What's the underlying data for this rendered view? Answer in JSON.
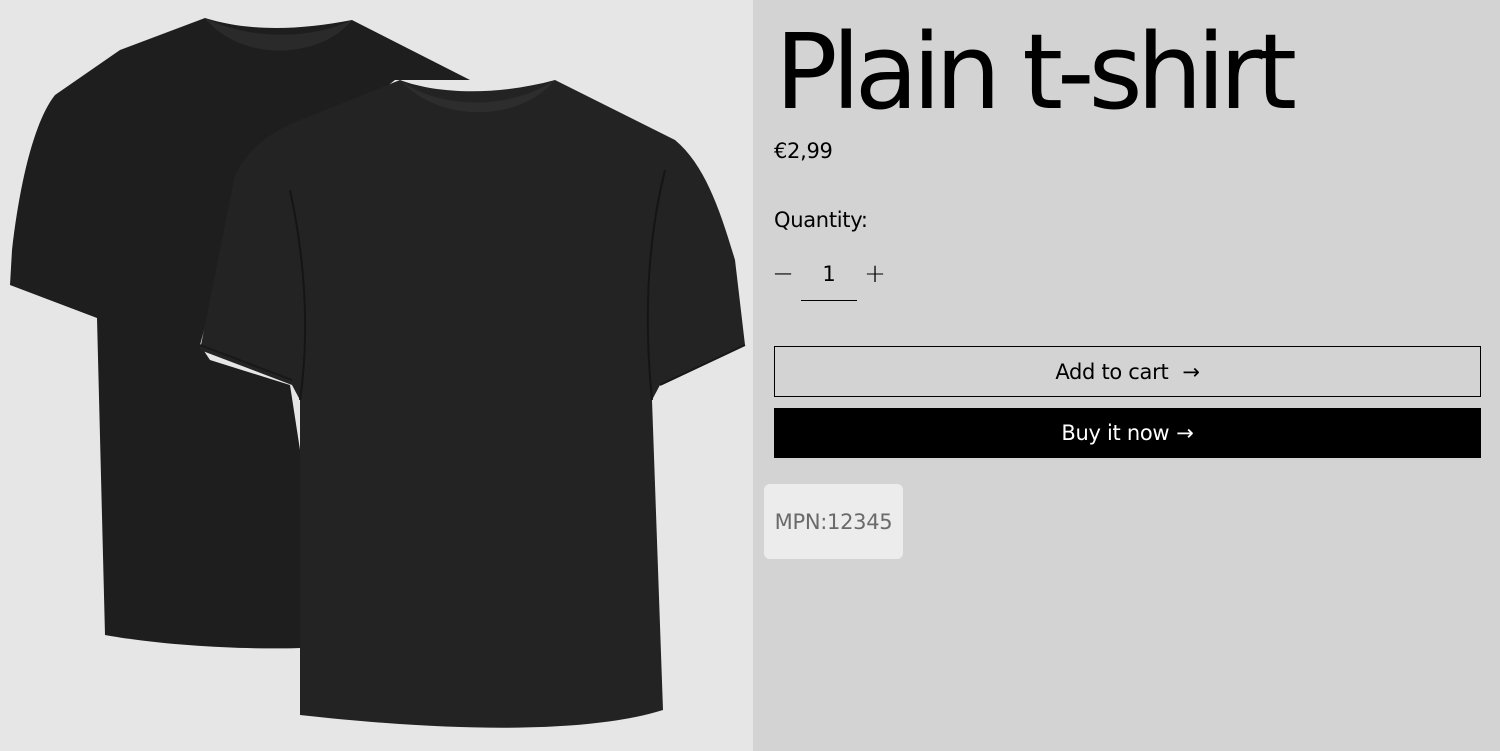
{
  "product": {
    "title": "Plain t-shirt",
    "price": "€2,99",
    "image_alt": "two black t-shirts",
    "colors": {
      "shirt": "#222222",
      "image_background": "#e6e6e6",
      "page_background": "#d3d3d3"
    }
  },
  "quantity": {
    "label": "Quantity:",
    "decrease_symbol": "−",
    "value": "1",
    "increase_symbol": "+"
  },
  "actions": {
    "add_to_cart_label": "Add to cart",
    "add_to_cart_arrow": "→",
    "buy_now_label": "Buy it now",
    "buy_now_arrow": "→"
  },
  "meta": {
    "mpn": "MPN:12345"
  }
}
